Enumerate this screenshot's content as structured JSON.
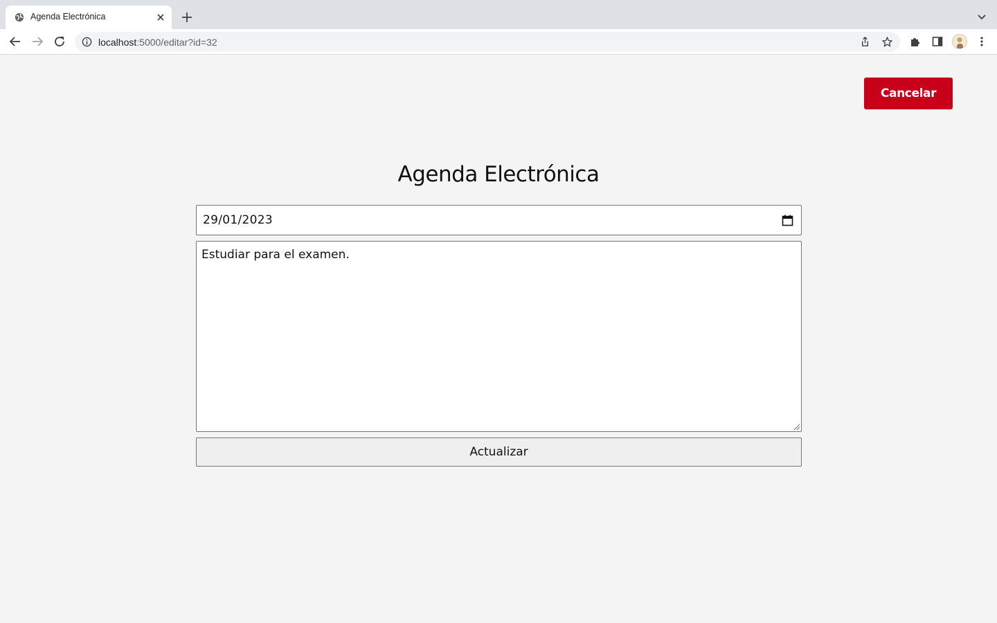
{
  "browser": {
    "tab": {
      "title": "Agenda Electrónica",
      "favicon": "globe-icon"
    },
    "address": {
      "host": "localhost",
      "rest": ":5000/editar?id=32"
    },
    "icons": [
      "back-icon",
      "forward-icon",
      "reload-icon",
      "info-icon",
      "share-icon",
      "star-icon",
      "extensions-icon",
      "side-panel-icon",
      "profile-avatar",
      "menu-icon"
    ]
  },
  "page": {
    "cancel_label": "Cancelar",
    "title": "Agenda Electrónica",
    "date_value": "29/01/2023",
    "note_value": "Estudiar para el examen.",
    "submit_label": "Actualizar"
  },
  "colors": {
    "accent": "#c9001a",
    "background": "#f4f4f4"
  }
}
